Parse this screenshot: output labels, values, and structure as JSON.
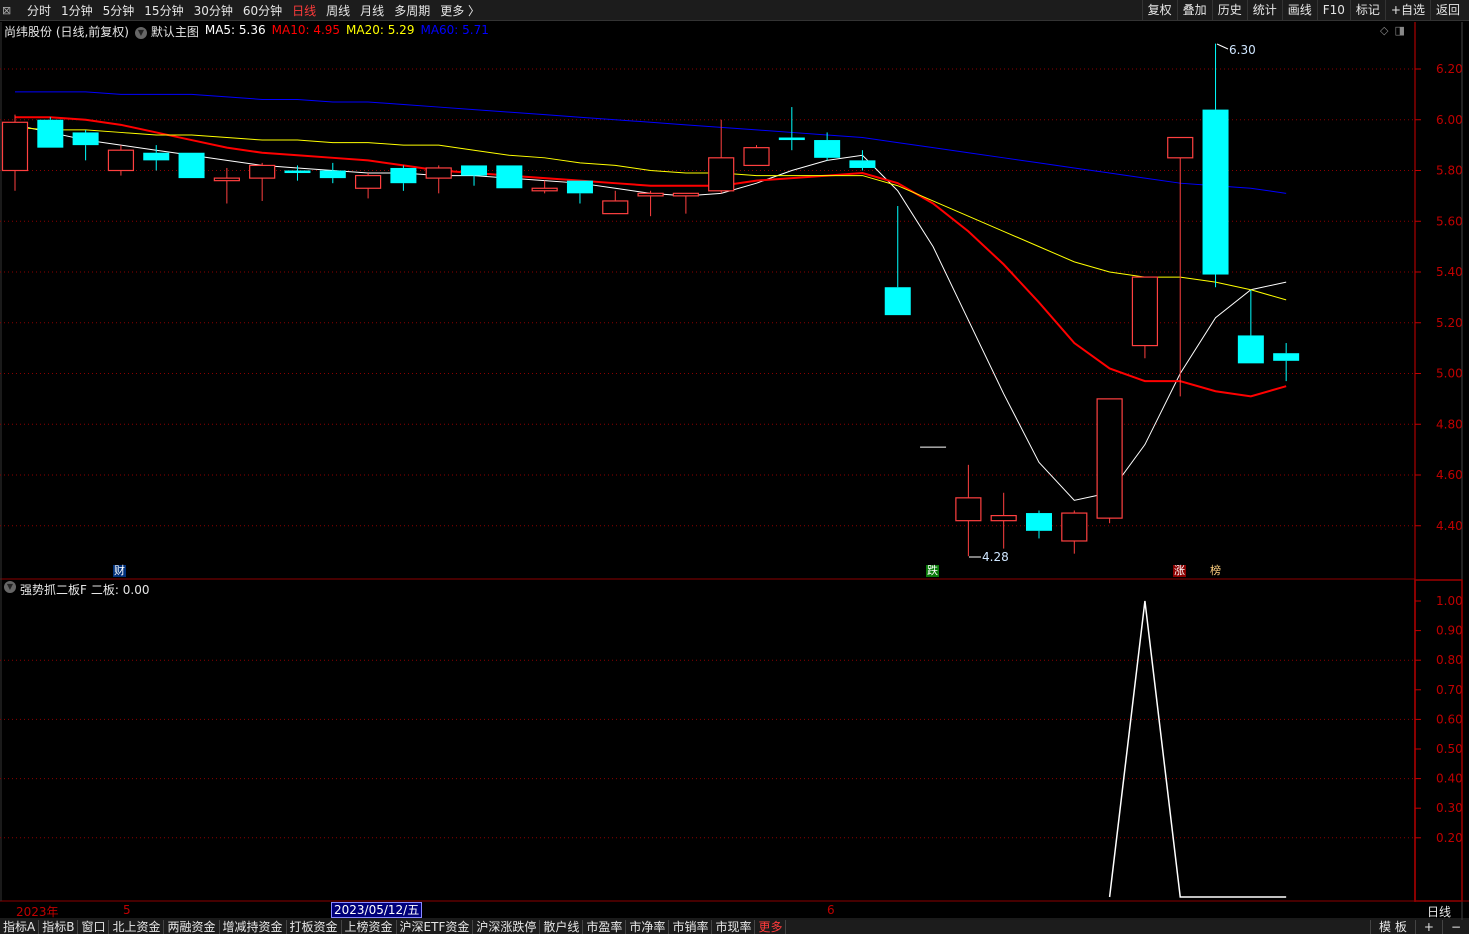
{
  "topbar": {
    "periods": [
      "分时",
      "1分钟",
      "5分钟",
      "15分钟",
      "30分钟",
      "60分钟",
      "日线",
      "周线",
      "月线",
      "多周期",
      "更多 〉"
    ],
    "active_period": "日线",
    "right_buttons": [
      "复权",
      "叠加",
      "历史",
      "统计",
      "画线",
      "F10",
      "标记",
      "+自选",
      "返回"
    ]
  },
  "legend": {
    "title": "尚纬股份 (日线,前复权)",
    "main_chart": "默认主图",
    "ma5": "MA5: 5.36",
    "ma10": "MA10: 4.95",
    "ma20": "MA20: 5.29",
    "ma60": "MA60: 5.71"
  },
  "indicator": {
    "name": "强势抓二板F",
    "value": "二板: 0.00"
  },
  "colors": {
    "up": "#ff4040",
    "down": "#00ffff",
    "ma5": "#ffffff",
    "ma10": "#ff0000",
    "ma20": "#ffff00",
    "ma60": "#0000ff",
    "axis": "#c00000",
    "grid": "#8b0000"
  },
  "annotations": {
    "high": "6.30",
    "low": "4.28"
  },
  "markers": {
    "cai": "财",
    "die": "跌",
    "zhang": "涨",
    "bang": "榜"
  },
  "xaxis": {
    "year": "2023年",
    "m5": "5",
    "m6": "6",
    "crosshair_date": "2023/05/12/五",
    "period_label": "日线"
  },
  "bottombar": {
    "tabs": [
      "指标A",
      "指标B",
      "窗口",
      "北上资金",
      "两融资金",
      "增减持资金",
      "打板资金",
      "上榜资金",
      "沪深ETF资金",
      "沪深涨跌停",
      "散户线",
      "市盈率",
      "市净率",
      "市销率",
      "市现率"
    ],
    "more": "更多",
    "right": [
      "模 板",
      "+",
      "−"
    ]
  },
  "chart_data": [
    {
      "type": "candlestick",
      "title": "尚纬股份 (日线,前复权)",
      "yticks": [
        "6.20",
        "6.00",
        "5.80",
        "5.60",
        "5.40",
        "5.20",
        "5.00",
        "4.80",
        "4.60",
        "4.40"
      ],
      "ylim": [
        4.28,
        6.3
      ],
      "grid": true,
      "candles": [
        {
          "o": 5.8,
          "h": 6.02,
          "l": 5.72,
          "c": 5.99
        },
        {
          "o": 6.0,
          "h": 6.01,
          "l": 5.89,
          "c": 5.89
        },
        {
          "o": 5.95,
          "h": 5.96,
          "l": 5.84,
          "c": 5.9
        },
        {
          "o": 5.8,
          "h": 5.9,
          "l": 5.78,
          "c": 5.88
        },
        {
          "o": 5.87,
          "h": 5.9,
          "l": 5.8,
          "c": 5.84
        },
        {
          "o": 5.87,
          "h": 5.87,
          "l": 5.77,
          "c": 5.77
        },
        {
          "o": 5.76,
          "h": 5.81,
          "l": 5.67,
          "c": 5.77
        },
        {
          "o": 5.77,
          "h": 5.83,
          "l": 5.68,
          "c": 5.82
        },
        {
          "o": 5.8,
          "h": 5.82,
          "l": 5.76,
          "c": 5.79
        },
        {
          "o": 5.8,
          "h": 5.83,
          "l": 5.75,
          "c": 5.77
        },
        {
          "o": 5.73,
          "h": 5.79,
          "l": 5.69,
          "c": 5.78
        },
        {
          "o": 5.81,
          "h": 5.82,
          "l": 5.72,
          "c": 5.75
        },
        {
          "o": 5.77,
          "h": 5.82,
          "l": 5.71,
          "c": 5.81
        },
        {
          "o": 5.82,
          "h": 5.82,
          "l": 5.74,
          "c": 5.78
        },
        {
          "o": 5.82,
          "h": 5.82,
          "l": 5.73,
          "c": 5.73
        },
        {
          "o": 5.72,
          "h": 5.76,
          "l": 5.71,
          "c": 5.73
        },
        {
          "o": 5.76,
          "h": 5.76,
          "l": 5.67,
          "c": 5.71
        },
        {
          "o": 5.63,
          "h": 5.72,
          "l": 5.63,
          "c": 5.68
        },
        {
          "o": 5.7,
          "h": 5.72,
          "l": 5.62,
          "c": 5.71
        },
        {
          "o": 5.7,
          "h": 5.71,
          "l": 5.63,
          "c": 5.71
        },
        {
          "o": 5.72,
          "h": 6.0,
          "l": 5.71,
          "c": 5.85
        },
        {
          "o": 5.82,
          "h": 5.9,
          "l": 5.82,
          "c": 5.89
        },
        {
          "o": 5.93,
          "h": 6.05,
          "l": 5.88,
          "c": 5.92
        },
        {
          "o": 5.92,
          "h": 5.95,
          "l": 5.84,
          "c": 5.85
        },
        {
          "o": 5.84,
          "h": 5.88,
          "l": 5.8,
          "c": 5.81
        },
        {
          "o": 5.34,
          "h": 5.66,
          "l": 5.23,
          "c": 5.23
        },
        {
          "o": 4.71,
          "h": 4.71,
          "l": 4.71,
          "c": 4.71,
          "flat": true
        },
        {
          "o": 4.42,
          "h": 4.64,
          "l": 4.28,
          "c": 4.51
        },
        {
          "o": 4.42,
          "h": 4.53,
          "l": 4.31,
          "c": 4.44
        },
        {
          "o": 4.45,
          "h": 4.46,
          "l": 4.35,
          "c": 4.38
        },
        {
          "o": 4.34,
          "h": 4.46,
          "l": 4.29,
          "c": 4.45
        },
        {
          "o": 4.43,
          "h": 4.9,
          "l": 4.41,
          "c": 4.9
        },
        {
          "o": 5.11,
          "h": 5.38,
          "l": 5.06,
          "c": 5.38
        },
        {
          "o": 5.85,
          "h": 5.93,
          "l": 4.91,
          "c": 5.93
        },
        {
          "o": 6.04,
          "h": 6.3,
          "l": 5.34,
          "c": 5.39
        },
        {
          "o": 5.15,
          "h": 5.33,
          "l": 5.04,
          "c": 5.04
        },
        {
          "o": 5.08,
          "h": 5.12,
          "l": 4.97,
          "c": 5.05
        }
      ],
      "series": [
        {
          "name": "MA5",
          "values": [
            5.98,
            5.95,
            5.92,
            5.9,
            5.88,
            5.86,
            5.84,
            5.82,
            5.81,
            5.8,
            5.79,
            5.79,
            5.78,
            5.78,
            5.77,
            5.76,
            5.75,
            5.73,
            5.71,
            5.7,
            5.71,
            5.75,
            5.8,
            5.84,
            5.86,
            5.72,
            5.5,
            5.21,
            4.92,
            4.65,
            4.5,
            4.53,
            4.72,
            5.0,
            5.22,
            5.33,
            5.36
          ]
        },
        {
          "name": "MA10",
          "values": [
            6.01,
            6.01,
            6.0,
            5.98,
            5.95,
            5.92,
            5.89,
            5.87,
            5.86,
            5.85,
            5.84,
            5.82,
            5.8,
            5.79,
            5.78,
            5.77,
            5.76,
            5.75,
            5.74,
            5.74,
            5.74,
            5.76,
            5.77,
            5.78,
            5.79,
            5.75,
            5.67,
            5.56,
            5.43,
            5.28,
            5.12,
            5.02,
            4.97,
            4.97,
            4.93,
            4.91,
            4.95
          ]
        },
        {
          "name": "MA20",
          "values": [
            5.97,
            5.96,
            5.96,
            5.95,
            5.94,
            5.94,
            5.93,
            5.92,
            5.92,
            5.91,
            5.91,
            5.9,
            5.9,
            5.88,
            5.86,
            5.85,
            5.83,
            5.82,
            5.8,
            5.79,
            5.79,
            5.78,
            5.78,
            5.78,
            5.78,
            5.74,
            5.68,
            5.62,
            5.56,
            5.5,
            5.44,
            5.4,
            5.38,
            5.38,
            5.36,
            5.33,
            5.29
          ]
        },
        {
          "name": "MA60",
          "values": [
            6.11,
            6.11,
            6.11,
            6.1,
            6.1,
            6.1,
            6.09,
            6.08,
            6.08,
            6.07,
            6.07,
            6.06,
            6.05,
            6.04,
            6.03,
            6.02,
            6.01,
            6.0,
            5.99,
            5.98,
            5.97,
            5.96,
            5.95,
            5.94,
            5.93,
            5.91,
            5.89,
            5.87,
            5.85,
            5.83,
            5.81,
            5.79,
            5.77,
            5.75,
            5.74,
            5.73,
            5.71
          ]
        }
      ]
    },
    {
      "type": "line",
      "title": "强势抓二板F",
      "yticks": [
        "1.00",
        "0.90",
        "0.80",
        "0.70",
        "0.60",
        "0.50",
        "0.40",
        "0.30",
        "0.20"
      ],
      "ylim": [
        0,
        1
      ],
      "grid": true,
      "series": [
        {
          "name": "二板",
          "start_index": 31,
          "values": [
            0,
            1,
            0,
            0,
            0,
            0
          ]
        }
      ]
    }
  ]
}
